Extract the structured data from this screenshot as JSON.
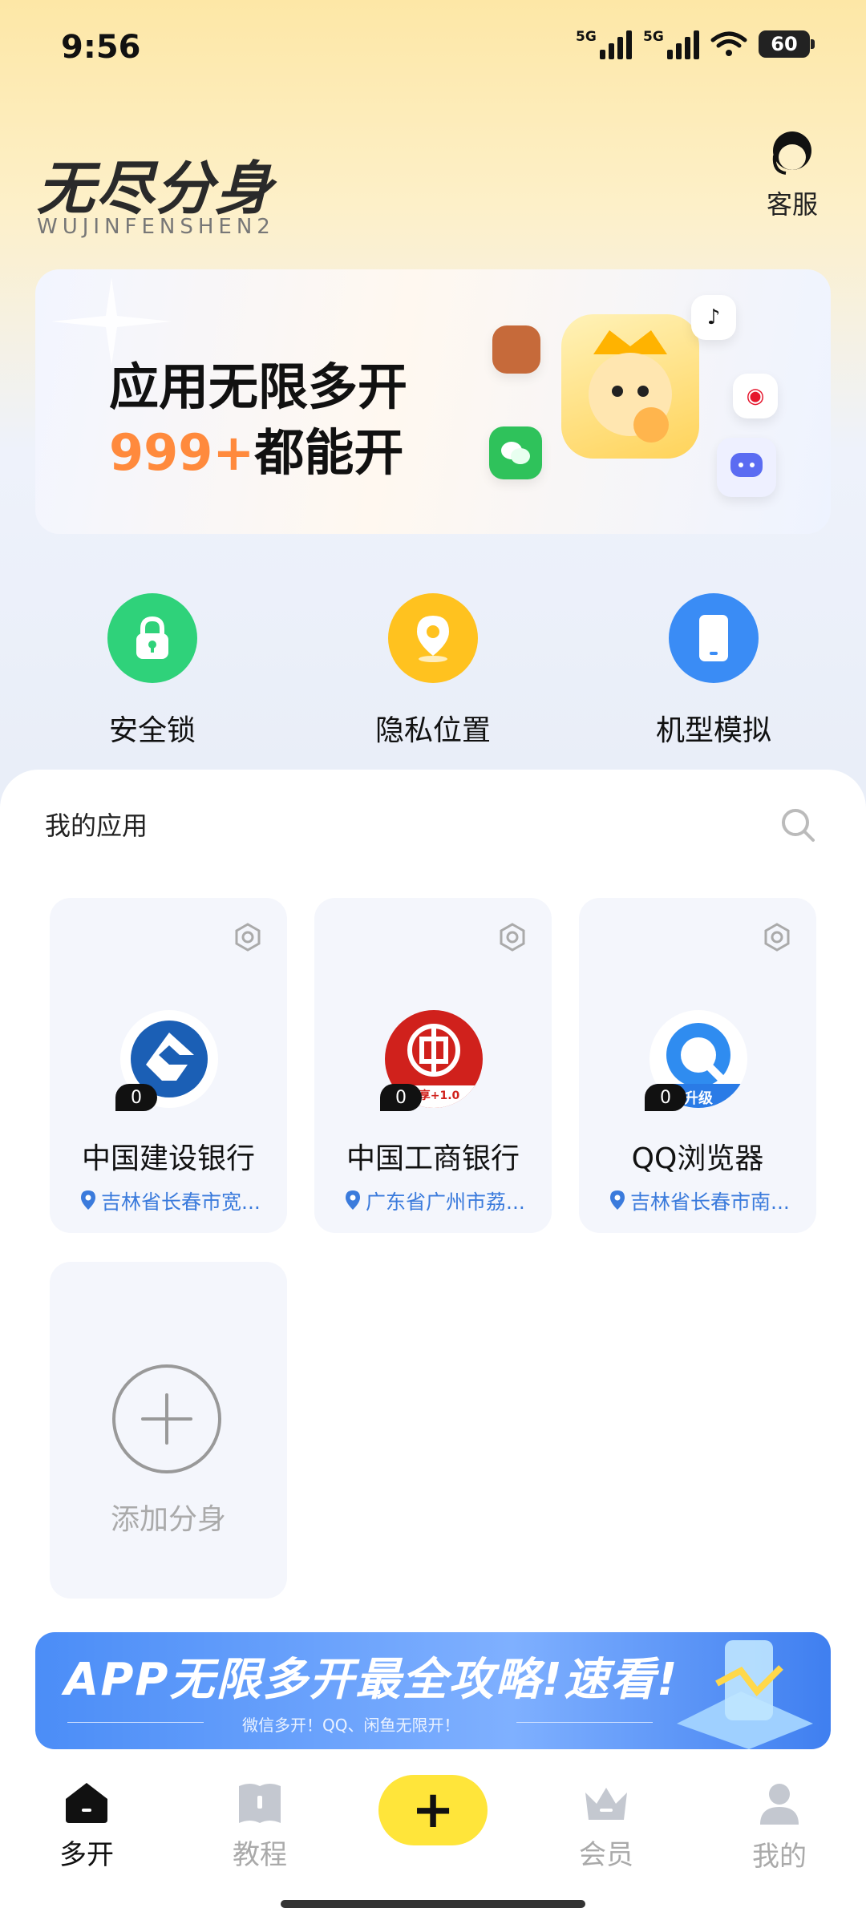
{
  "status_bar": {
    "time": "9:56",
    "signal_1": "5G",
    "signal_2": "5G",
    "battery": "60",
    "icons": [
      "signal-icon",
      "signal-icon",
      "wifi-icon",
      "battery-icon"
    ]
  },
  "header": {
    "logo_text": "无尽分身",
    "logo_subtitle": "WUJINFENSHEN2",
    "service_label": "客服",
    "service_icon": "customer-service-icon"
  },
  "banner": {
    "line1": "应用无限多开",
    "line2_highlight": "999+",
    "line2_rest": "都能开",
    "highlight_color": "#ff8a3d"
  },
  "features": [
    {
      "label": "安全锁",
      "icon": "lock-icon",
      "color": "#2fd27a"
    },
    {
      "label": "隐私位置",
      "icon": "location-pin-icon",
      "color": "#ffc21f"
    },
    {
      "label": "机型模拟",
      "icon": "phone-icon",
      "color": "#3a8cf5"
    }
  ],
  "my_apps": {
    "title": "我的应用",
    "search_icon": "search-icon",
    "apps": [
      {
        "name": "中国建设银行",
        "count": "0",
        "location": "吉林省长春市宽...",
        "icon": "ccb-bank-icon"
      },
      {
        "name": "中国工商银行",
        "count": "0",
        "location": "广东省广州市荔...",
        "icon": "icbc-bank-icon",
        "icon_caption": "尊享+1.0"
      },
      {
        "name": "QQ浏览器",
        "count": "0",
        "location": "吉林省长春市南...",
        "icon": "qq-browser-icon",
        "icon_caption": "升级"
      }
    ],
    "add_label": "添加分身"
  },
  "promo": {
    "title": "APP无限多开最全攻略!速看!",
    "subtitle": "微信多开！QQ、闲鱼无限开！"
  },
  "tabbar": {
    "tabs": [
      {
        "label": "多开",
        "icon": "home-icon",
        "active": true
      },
      {
        "label": "教程",
        "icon": "book-icon",
        "active": false
      },
      {
        "label": "会员",
        "icon": "crown-icon",
        "active": false
      },
      {
        "label": "我的",
        "icon": "profile-icon",
        "active": false
      }
    ],
    "fab_label": "+"
  }
}
